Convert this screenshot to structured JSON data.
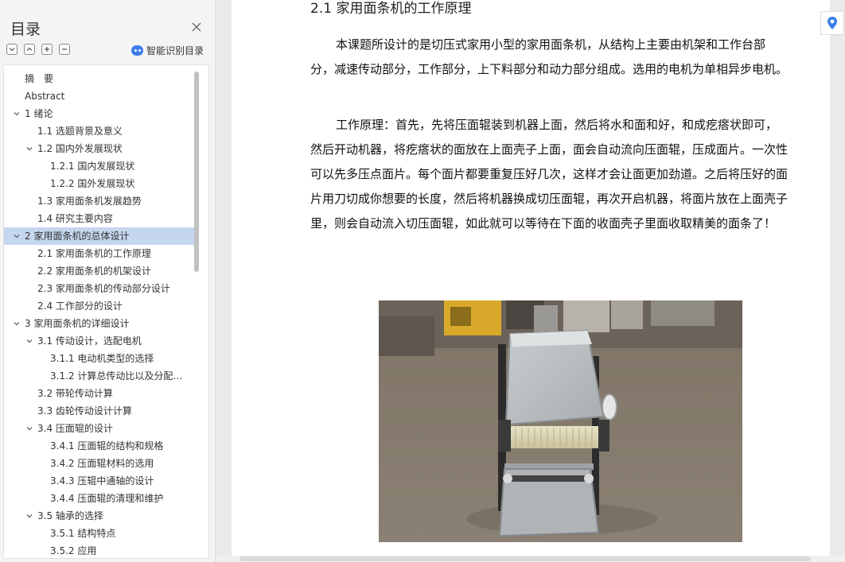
{
  "sidebar": {
    "title": "目录",
    "smart_toc_label": "智能识别目录",
    "toc": [
      {
        "label": "摘　要",
        "level": 0,
        "chevron": "none"
      },
      {
        "label": "Abstract",
        "level": 0,
        "chevron": "none"
      },
      {
        "label": "1 绪论",
        "level": 0,
        "chevron": "down"
      },
      {
        "label": "1.1 选题背景及意义",
        "level": 1,
        "chevron": "none"
      },
      {
        "label": "1.2 国内外发展现状",
        "level": 1,
        "chevron": "down"
      },
      {
        "label": "1.2.1 国内发展现状",
        "level": 2,
        "chevron": "none"
      },
      {
        "label": "1.2.2 国外发展现状",
        "level": 2,
        "chevron": "none"
      },
      {
        "label": "1.3 家用面条机发展趋势",
        "level": 1,
        "chevron": "none"
      },
      {
        "label": "1.4 研究主要内容",
        "level": 1,
        "chevron": "none"
      },
      {
        "label": "2 家用面条机的总体设计",
        "level": 0,
        "chevron": "down",
        "selected": true
      },
      {
        "label": "2.1 家用面条机的工作原理",
        "level": 1,
        "chevron": "none"
      },
      {
        "label": "2.2 家用面条机的机架设计",
        "level": 1,
        "chevron": "none"
      },
      {
        "label": "2.3 家用面条机的传动部分设计",
        "level": 1,
        "chevron": "none"
      },
      {
        "label": "2.4 工作部分的设计",
        "level": 1,
        "chevron": "none"
      },
      {
        "label": "3 家用面条机的详细设计",
        "level": 0,
        "chevron": "down"
      },
      {
        "label": "3.1 传动设计，选配电机",
        "level": 1,
        "chevron": "down"
      },
      {
        "label": "3.1.1  电动机类型的选择",
        "level": 2,
        "chevron": "none"
      },
      {
        "label": "3.1.2  计算总传动比以及分配…",
        "level": 2,
        "chevron": "none"
      },
      {
        "label": "3.2  带轮传动计算",
        "level": 1,
        "chevron": "none"
      },
      {
        "label": "3.3  齿轮传动设计计算",
        "level": 1,
        "chevron": "none"
      },
      {
        "label": "3.4  压面辊的设计",
        "level": 1,
        "chevron": "down"
      },
      {
        "label": "3.4.1  压面辊的结构和规格",
        "level": 2,
        "chevron": "none"
      },
      {
        "label": "3.4.2  压面辊材料的选用",
        "level": 2,
        "chevron": "none"
      },
      {
        "label": "3.4.3  压辊中通轴的设计",
        "level": 2,
        "chevron": "none"
      },
      {
        "label": "3.4.4  压面辊的清理和维护",
        "level": 2,
        "chevron": "none"
      },
      {
        "label": "3.5  轴承的选择",
        "level": 1,
        "chevron": "down"
      },
      {
        "label": "3.5.1  结构特点",
        "level": 2,
        "chevron": "none"
      },
      {
        "label": "3.5.2  应用",
        "level": 2,
        "chevron": "none"
      }
    ]
  },
  "document": {
    "heading": "2.1 家用面条机的工作原理",
    "paragraphs": [
      "本课题所设计的是切压式家用小型的家用面条机，从结构上主要由机架和工作台部分，减速传动部分，工作部分，上下料部分和动力部分组成。选用的电机为单相异步电机。",
      "工作原理：首先，先将压面辊装到机器上面，然后将水和面和好，和成疙瘩状即可，然后开动机器，将疙瘩状的面放在上面壳子上面，面会自动流向压面辊，压成面片。一次性可以先多压点面片。每个面片都要重复压好几次，这样才会让面更加劲道。之后将压好的面片用刀切成你想要的长度，然后将机器换成切压面辊，再次开启机器，将面片放在上面壳子里，则会自动流入切压面辊，如此就可以等待在下面的收面壳子里面收取精美的面条了！"
    ]
  },
  "colors": {
    "accent": "#3b7de9",
    "selected_row": "#c5d6ef"
  },
  "icons": {
    "close": "close-icon",
    "collapse_all": "collapse-all-icon",
    "expand_all": "expand-all-icon",
    "add": "plus-icon",
    "remove": "minus-icon",
    "locate": "location-pin-icon"
  }
}
